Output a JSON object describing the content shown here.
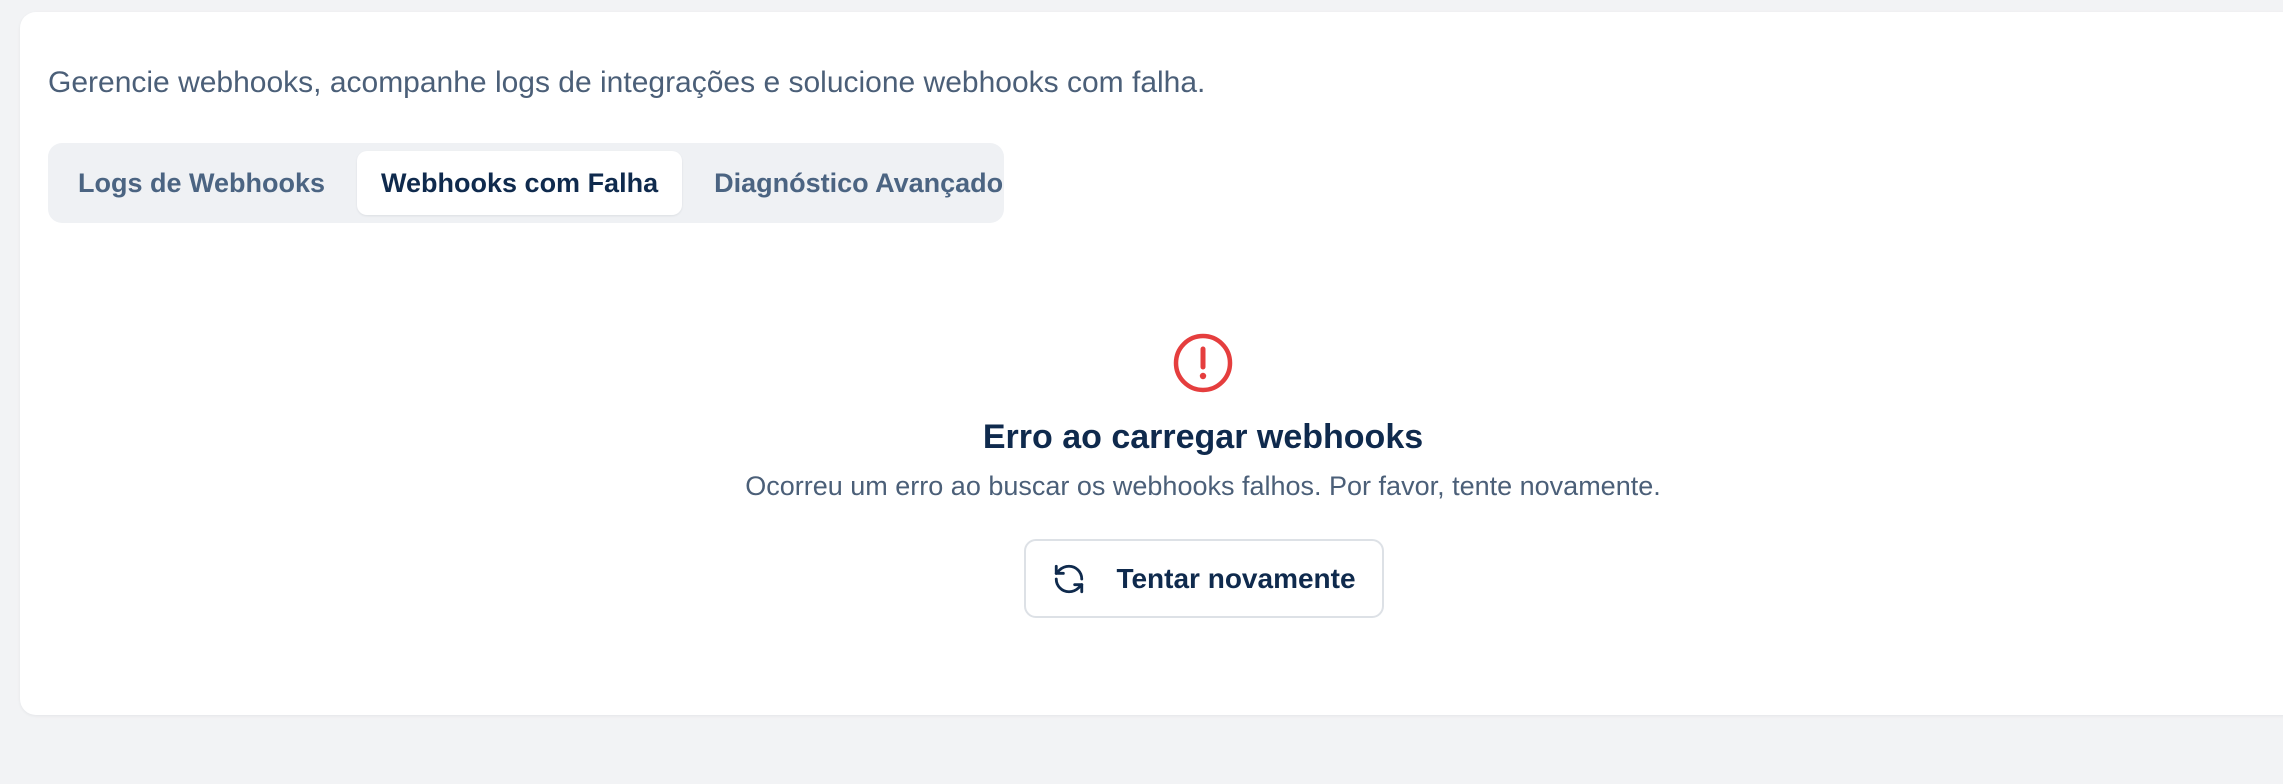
{
  "page": {
    "description": "Gerencie webhooks, acompanhe logs de integrações e solucione webhooks com falha."
  },
  "tabs": [
    {
      "label": "Logs de Webhooks",
      "active": false
    },
    {
      "label": "Webhooks com Falha",
      "active": true
    },
    {
      "label": "Diagnóstico Avançado",
      "active": false
    }
  ],
  "error": {
    "icon": "alert-circle-icon",
    "title": "Erro ao carregar webhooks",
    "message": "Ocorreu um erro ao buscar os webhooks falhos. Por favor, tente novamente.",
    "retry_label": "Tentar novamente",
    "retry_icon": "refresh-icon"
  },
  "colors": {
    "error": "#e53e3e",
    "text_primary": "#0f2a4d",
    "text_secondary": "#4b5f78",
    "background": "#f2f3f5",
    "card": "#ffffff"
  }
}
